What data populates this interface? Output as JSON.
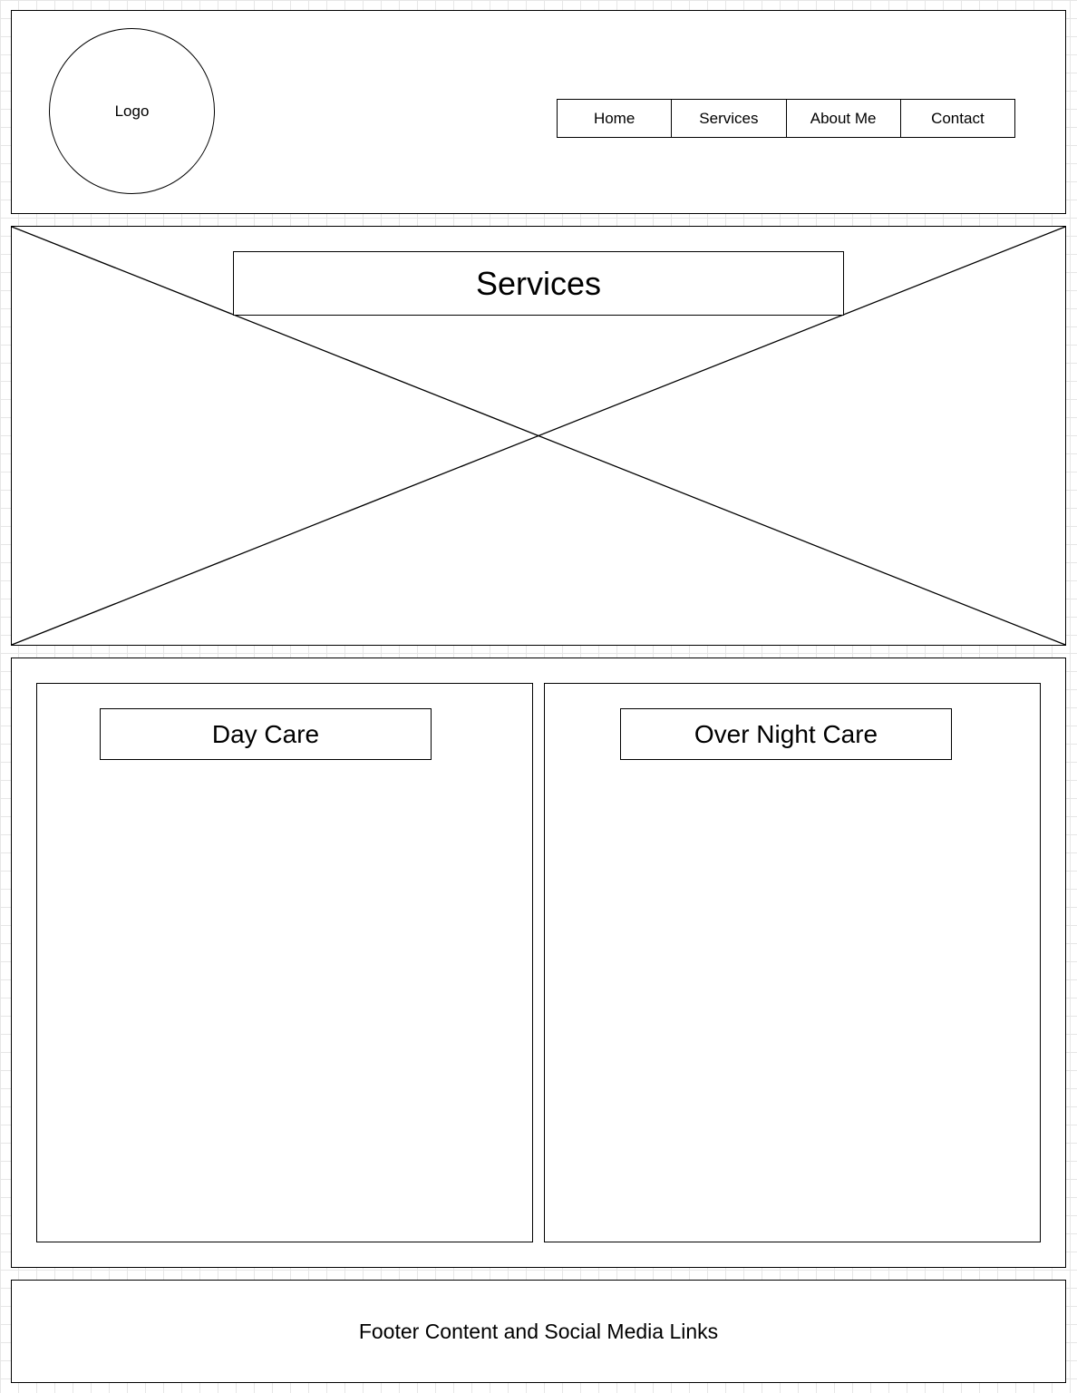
{
  "header": {
    "logo_label": "Logo",
    "nav": [
      {
        "label": "Home"
      },
      {
        "label": "Services"
      },
      {
        "label": "About Me"
      },
      {
        "label": "Contact"
      }
    ]
  },
  "hero": {
    "title": "Services",
    "image_placeholder": "image-placeholder"
  },
  "services": {
    "cards": [
      {
        "title": "Day Care"
      },
      {
        "title": "Over Night Care"
      }
    ]
  },
  "footer": {
    "text": "Footer Content and Social Media Links"
  }
}
